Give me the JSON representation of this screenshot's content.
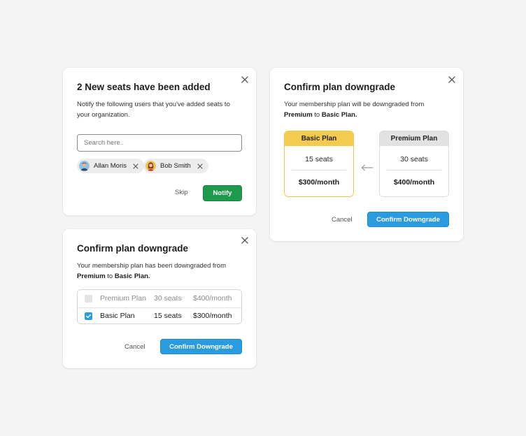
{
  "card_seats": {
    "title": "2 New seats have been added",
    "description": "Notify the following users that you've added seats to your organization.",
    "search_placeholder": "Search here..",
    "users": [
      {
        "name": "Allan Moris",
        "avatar": "avatar-man-icon"
      },
      {
        "name": "Bob Smith",
        "avatar": "avatar-woman-icon"
      }
    ],
    "skip_label": "Skip",
    "notify_label": "Notify",
    "accent": "#1e9a4f"
  },
  "card_downgraded": {
    "title": "Confirm plan downgrade",
    "description_prefix": "Your membership plan has been downgraded from ",
    "from_plan": "Premium",
    "to_word": " to ",
    "to_plan": "Basic Plan.",
    "rows": [
      {
        "name": "Premium Plan",
        "seats": "30 seats",
        "price": "$400/month",
        "checked": false
      },
      {
        "name": "Basic Plan",
        "seats": "15 seats",
        "price": "$300/month",
        "checked": true
      }
    ],
    "cancel_label": "Cancel",
    "confirm_label": "Confirm Downgrade",
    "accent": "#2b9be0"
  },
  "card_compare": {
    "title": "Confirm plan downgrade",
    "description_prefix": "Your membership plan will be downgraded from ",
    "from_plan": "Premium",
    "to_word": " to ",
    "to_plan": "Basic Plan.",
    "basic": {
      "name": "Basic Plan",
      "seats": "15 seats",
      "price": "$300/month",
      "color": "#f4cb4f"
    },
    "premium": {
      "name": "Premium Plan",
      "seats": "30 seats",
      "price": "$400/month",
      "color": "#e2e2e2"
    },
    "cancel_label": "Cancel",
    "confirm_label": "Confirm Downgrade",
    "accent": "#2b9be0"
  }
}
